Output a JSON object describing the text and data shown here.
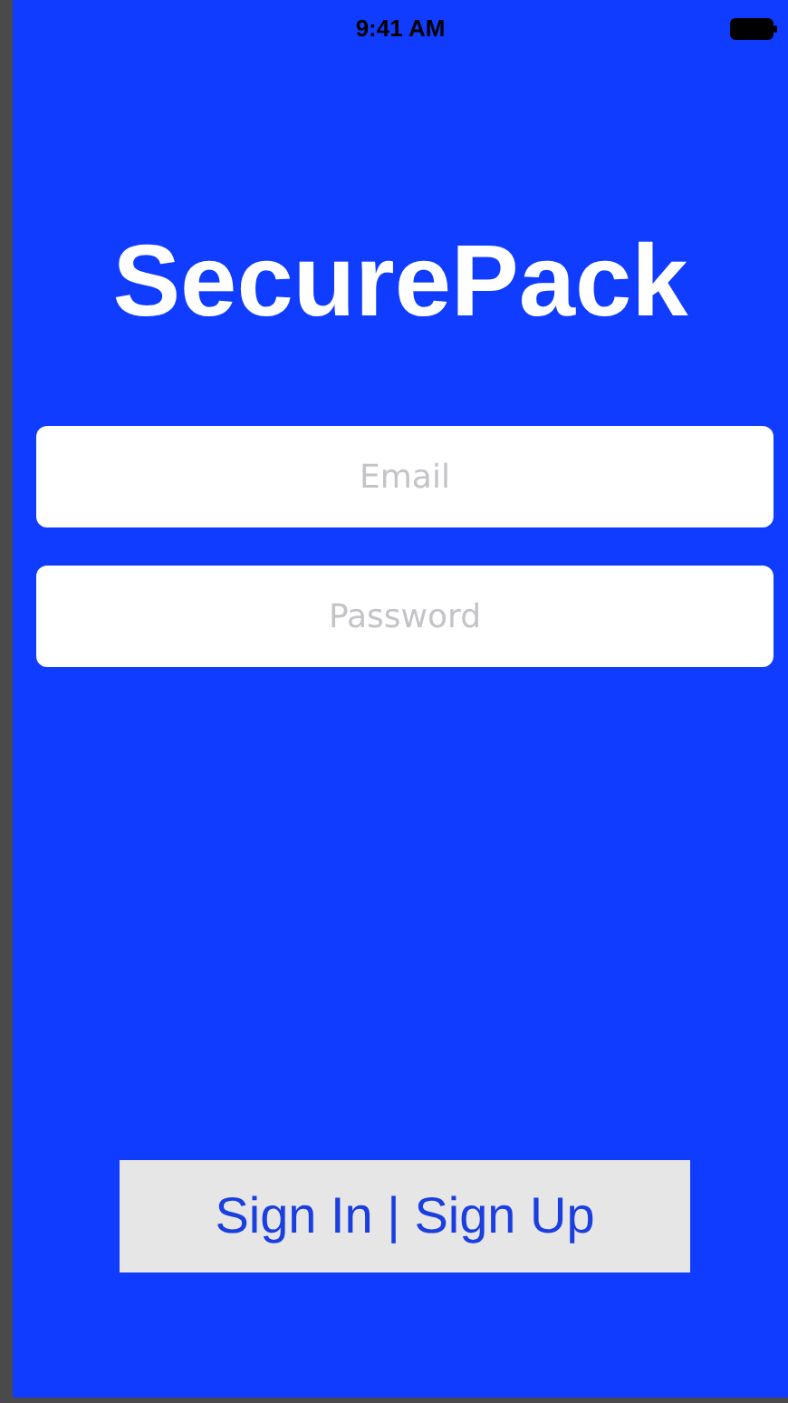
{
  "status_bar": {
    "time": "9:41 AM"
  },
  "title": "SecurePack",
  "fields": [
    {
      "placeholder": "Email"
    },
    {
      "placeholder": "Password"
    }
  ],
  "button": {
    "label": "Sign In | Sign Up"
  }
}
